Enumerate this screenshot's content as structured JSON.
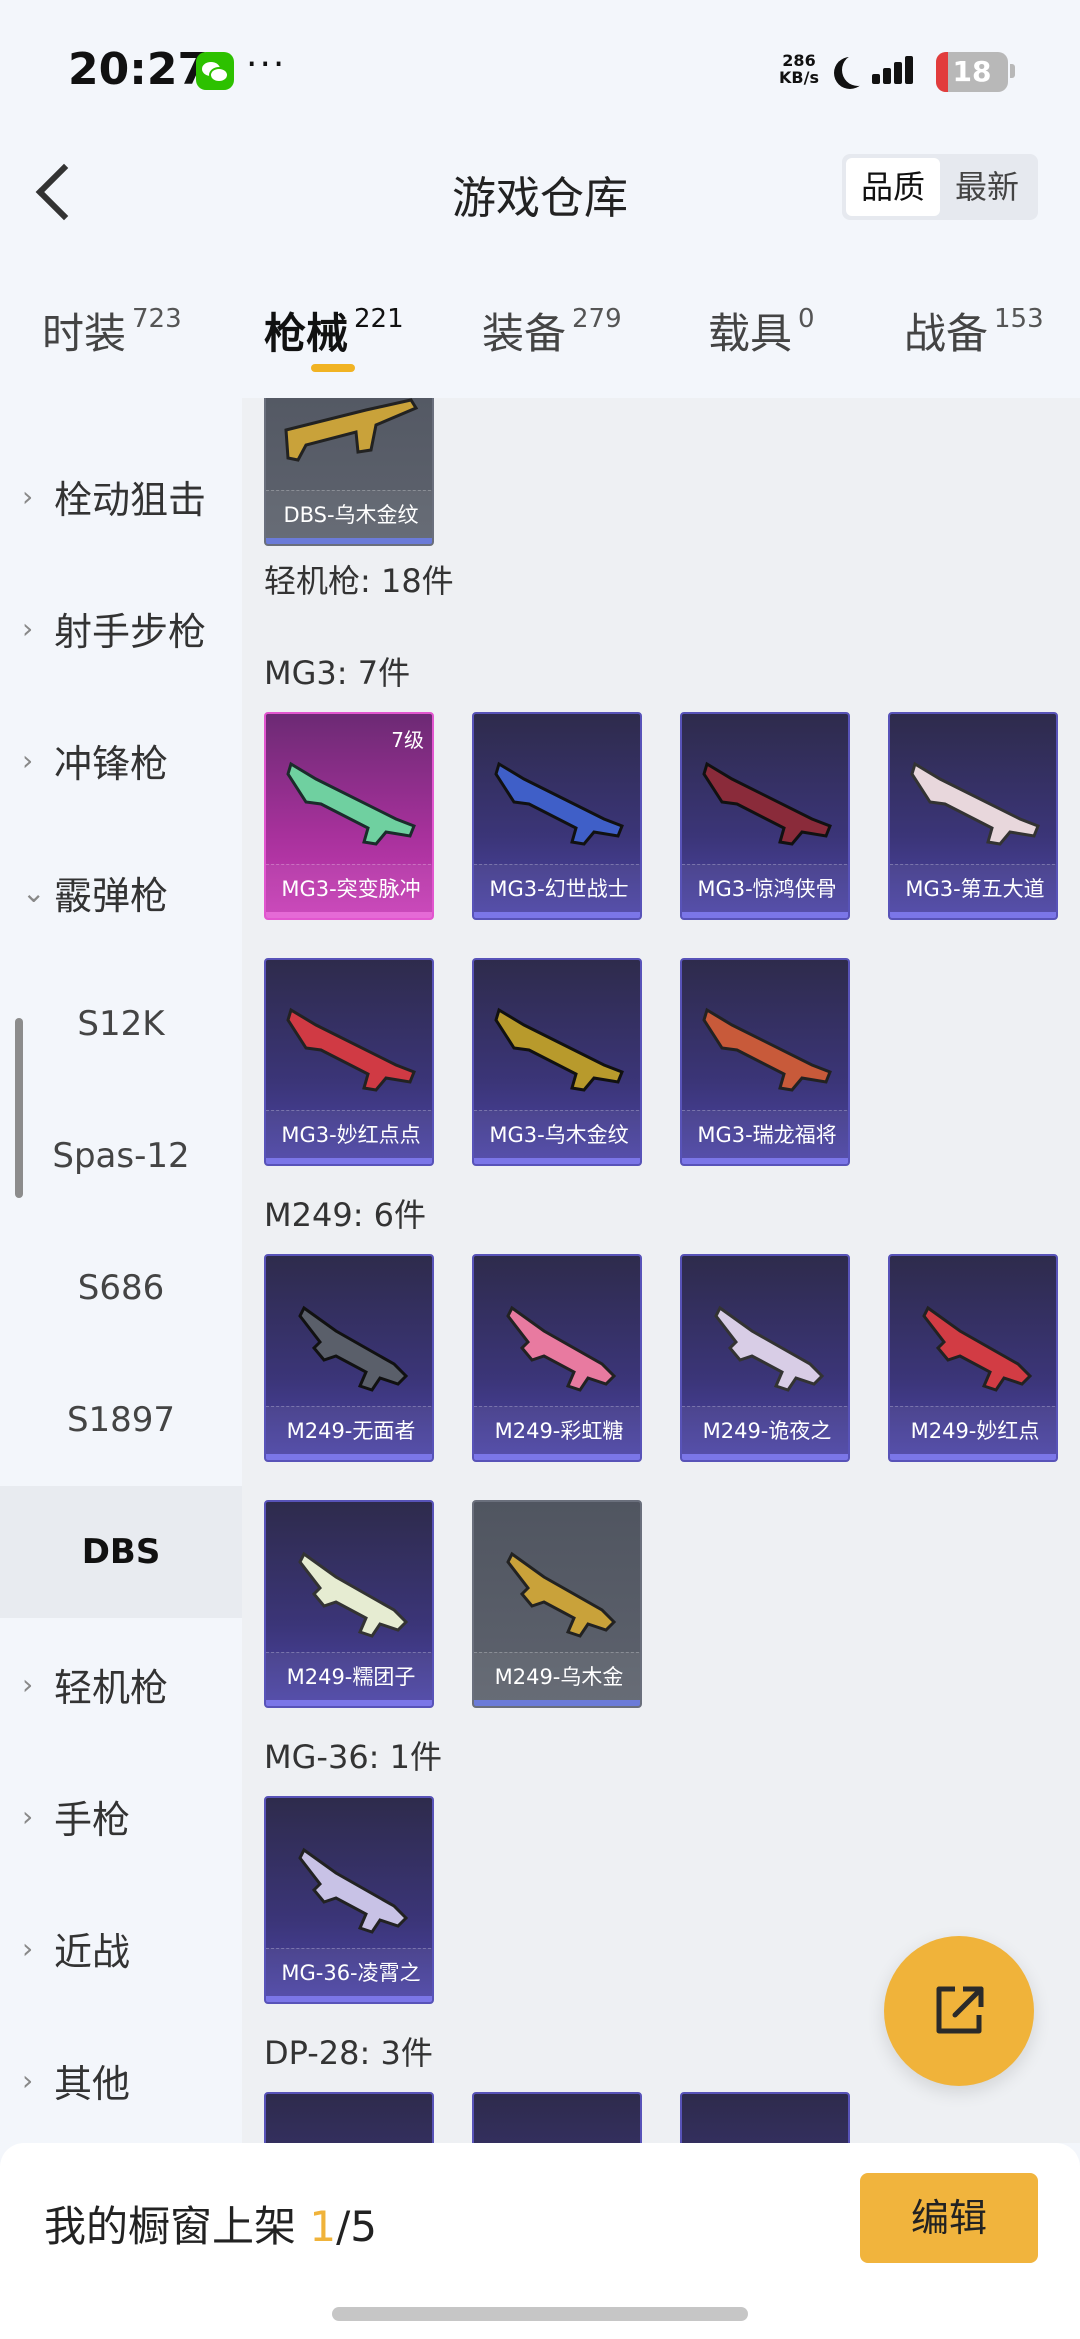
{
  "status_bar": {
    "time": "20:27",
    "more": "···",
    "net_speed_top": "286",
    "net_speed_bottom": "KB/s",
    "battery": "18",
    "icons": [
      "wechat-icon",
      "moon-icon",
      "signal-icon",
      "battery-icon"
    ]
  },
  "header": {
    "title": "游戏仓库",
    "back_icon": "chevron-left-icon",
    "sort_options": [
      "品质",
      "最新"
    ],
    "sort_selected": "品质"
  },
  "category_tabs": [
    {
      "label": "时装",
      "count": "723"
    },
    {
      "label": "枪械",
      "count": "221",
      "active": true
    },
    {
      "label": "装备",
      "count": "279"
    },
    {
      "label": "载具",
      "count": "0"
    },
    {
      "label": "战备",
      "count": "153"
    }
  ],
  "sidebar": [
    {
      "label": "栓动狙击",
      "chevron": "›"
    },
    {
      "label": "射手步枪",
      "chevron": "›"
    },
    {
      "label": "冲锋枪",
      "chevron": "›"
    },
    {
      "label": "霰弹枪",
      "chevron": "⌄"
    },
    {
      "label": "S12K"
    },
    {
      "label": "Spas-12"
    },
    {
      "label": "S686"
    },
    {
      "label": "S1897"
    },
    {
      "label": "DBS",
      "selected": true
    },
    {
      "label": "轻机枪",
      "chevron": "›"
    },
    {
      "label": "手枪",
      "chevron": "›"
    },
    {
      "label": "近战",
      "chevron": "›"
    },
    {
      "label": "其他",
      "chevron": "›"
    }
  ],
  "content": {
    "top_card": {
      "name": "DBS-乌木金纹"
    },
    "lmg_count_label": "轻机枪: 18件",
    "groups": [
      {
        "label": "MG3: 7件",
        "items": [
          {
            "name": "MG3-突变脉冲",
            "rarity": "pink",
            "level": "7级"
          },
          {
            "name": "MG3-幻世战士",
            "rarity": "purple"
          },
          {
            "name": "MG3-惊鸿侠骨",
            "rarity": "purple"
          },
          {
            "name": "MG3-第五大道",
            "rarity": "purple"
          },
          {
            "name": "MG3-妙红点点",
            "rarity": "purple"
          },
          {
            "name": "MG3-乌木金纹",
            "rarity": "purple"
          },
          {
            "name": "MG3-瑞龙福将",
            "rarity": "purple"
          }
        ]
      },
      {
        "label": "M249: 6件",
        "items": [
          {
            "name": "M249-无面者",
            "rarity": "purple"
          },
          {
            "name": "M249-彩虹糖",
            "rarity": "purple"
          },
          {
            "name": "M249-诡夜之",
            "rarity": "purple"
          },
          {
            "name": "M249-妙红点",
            "rarity": "purple"
          },
          {
            "name": "M249-糯团子",
            "rarity": "purple"
          },
          {
            "name": "M249-乌木金",
            "rarity": "gray"
          }
        ]
      },
      {
        "label": "MG-36: 1件",
        "items": [
          {
            "name": "MG-36-凌霄之",
            "rarity": "purple"
          }
        ]
      },
      {
        "label": "DP-28: 3件",
        "items": []
      }
    ]
  },
  "fab": {
    "icon": "share-export-icon"
  },
  "bottom_bar": {
    "showcase_prefix": "我的橱窗上架 ",
    "showcase_current": "1",
    "showcase_total": "/5",
    "edit_label": "编辑"
  }
}
